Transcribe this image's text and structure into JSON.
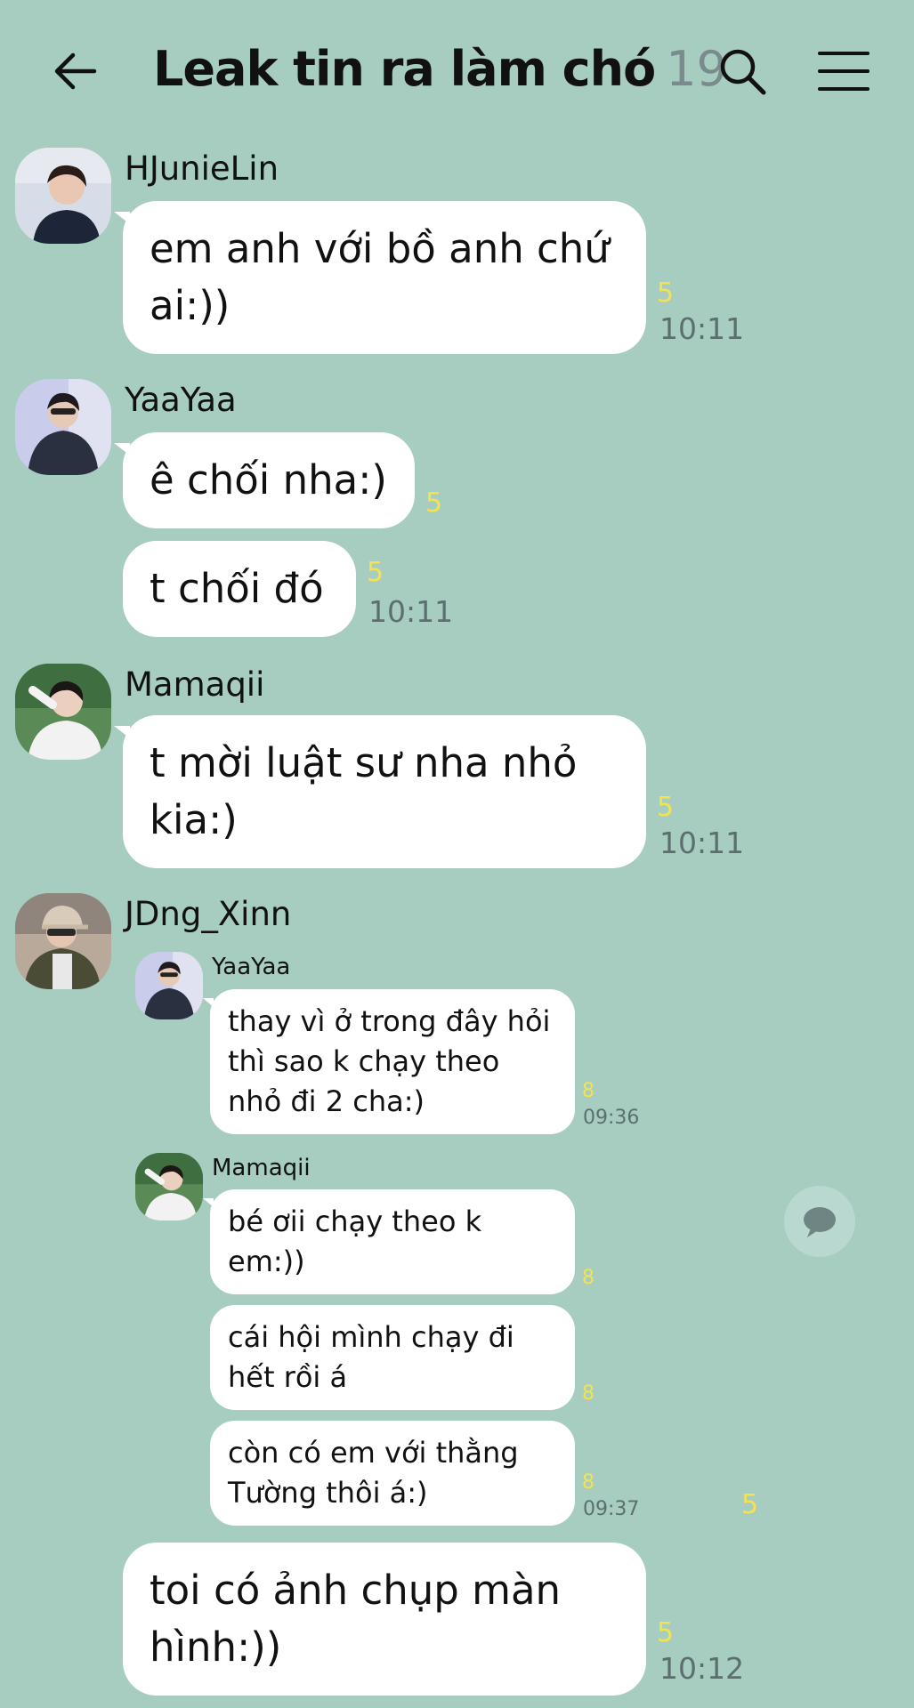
{
  "header": {
    "title": "Leak tin ra làm chó",
    "member_count": "19",
    "back_icon": "arrow-left-icon",
    "search_icon": "search-icon",
    "menu_icon": "hamburger-menu-icon"
  },
  "messages": [
    {
      "sender": "HJunieLin",
      "bubbles": [
        {
          "text": "em anh với bồ anh chứ ai:))",
          "unread": "5",
          "time": "10:11"
        }
      ]
    },
    {
      "sender": "YaaYaa",
      "bubbles": [
        {
          "text": "ê chối nha:)",
          "unread": "5"
        },
        {
          "text": "t chối đó",
          "unread": "5",
          "time": "10:11"
        }
      ]
    },
    {
      "sender": "Mamaqii",
      "bubbles": [
        {
          "text": "t mời luật sư nha nhỏ kia:)",
          "unread": "5",
          "time": "10:11"
        }
      ]
    },
    {
      "sender": "JDng_Xinn",
      "forwarded": [
        {
          "sender": "YaaYaa",
          "bubbles": [
            {
              "text": "thay vì ở trong đây hỏi thì sao k chạy theo nhỏ đi 2 cha:)",
              "unread": "8",
              "time": "09:36"
            }
          ]
        },
        {
          "sender": "Mamaqii",
          "bubbles": [
            {
              "text": "bé ơii chạy theo k em:))",
              "unread": "8"
            },
            {
              "text": "cái hội mình chạy đi hết rồi á",
              "unread": "8"
            },
            {
              "text": "còn có em với thằng Tường thôi á:)",
              "unread": "8",
              "time": "09:37"
            }
          ]
        }
      ],
      "forward_unread": "5",
      "bubbles": [
        {
          "text": "toi có ảnh chụp màn hình:))",
          "unread": "5",
          "time": "10:12"
        }
      ]
    }
  ],
  "fab_icon": "speech-bubble-icon",
  "colors": {
    "background": "#a6cdc0",
    "bubble": "#ffffff",
    "unread": "#f6e24d",
    "time": "#5c6f6f",
    "count": "#7a8b8d"
  }
}
